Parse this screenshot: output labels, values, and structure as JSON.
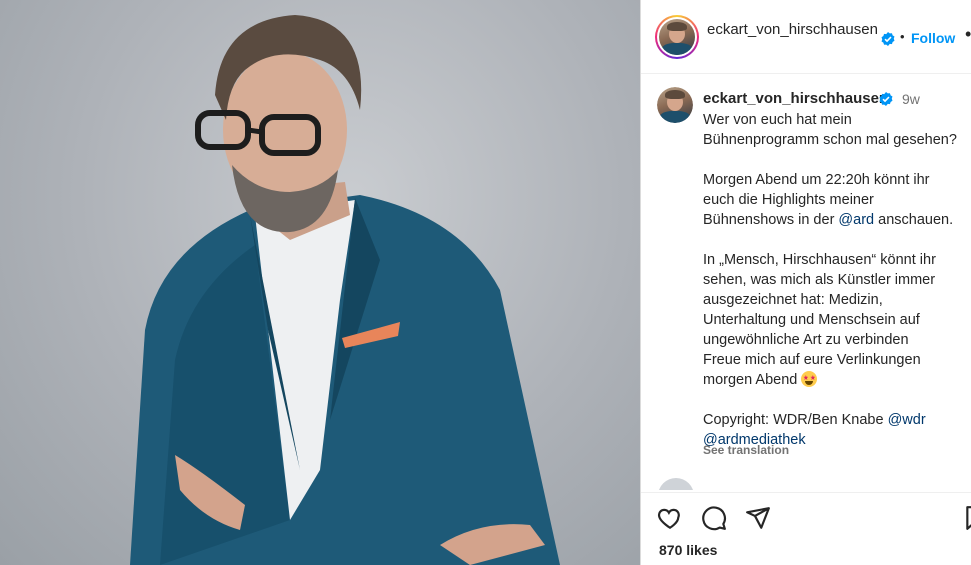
{
  "header": {
    "username": "eckart_von_hirschhausen",
    "follow_label": "Follow",
    "separator": "•",
    "more_label": "•"
  },
  "caption": {
    "username": "eckart_von_hirschhausen",
    "time": "9w",
    "line1": "Wer von euch hat mein",
    "line2": "Bühnenprogramm schon mal gesehen?",
    "line3": "Morgen Abend um 22:20h könnt ihr",
    "line4": "euch die Highlights meiner",
    "line5_pre": "Bühnenshows in der ",
    "mention_ard": "@ard",
    "line5_post": " anschauen.",
    "line6": "In „Mensch, Hirschhausen“ könnt ihr",
    "line7": "sehen, was mich als Künstler immer",
    "line8": "ausgezeichnet hat: Medizin,",
    "line9": "Unterhaltung und Menschsein auf",
    "line10": "ungewöhnliche Art zu verbinden",
    "line11": "Freue mich auf eure Verlinkungen",
    "line12": "morgen Abend",
    "line13_pre": "Copyright: WDR/Ben Knabe ",
    "mention_wdr": "@wdr",
    "mention_ardmediathek": "@ardmediathek",
    "see_translation": "See translation"
  },
  "actions": {
    "likes": "870 likes"
  },
  "colors": {
    "follow": "#0095f6",
    "verified": "#0095f6",
    "mention": "#00376b",
    "muted": "#737373"
  },
  "icons": [
    "heart-icon",
    "comment-icon",
    "share-icon",
    "bookmark-icon",
    "verified-badge-icon",
    "star-struck-emoji"
  ]
}
